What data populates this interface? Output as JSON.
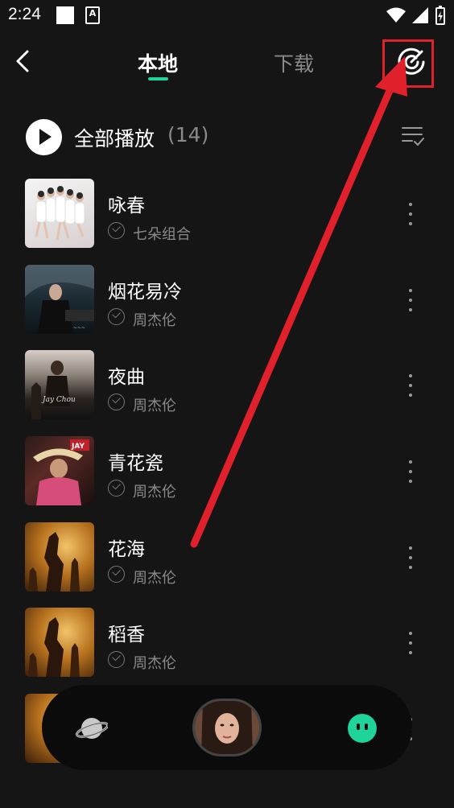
{
  "status_bar": {
    "time": "2:24"
  },
  "header": {
    "tabs": [
      "本地",
      "下载"
    ]
  },
  "play_all": {
    "label": "全部播放",
    "count": "(14)"
  },
  "songs": [
    {
      "title": "咏春",
      "artist": "七朵组合"
    },
    {
      "title": "烟花易冷",
      "artist": "周杰伦"
    },
    {
      "title": "夜曲",
      "artist": "周杰伦"
    },
    {
      "title": "青花瓷",
      "artist": "周杰伦"
    },
    {
      "title": "花海",
      "artist": "周杰伦"
    },
    {
      "title": "稻香",
      "artist": "周杰伦"
    }
  ],
  "colors": {
    "accent": "#1ed49b",
    "annotation": "#e0202a",
    "background": "#151515"
  }
}
